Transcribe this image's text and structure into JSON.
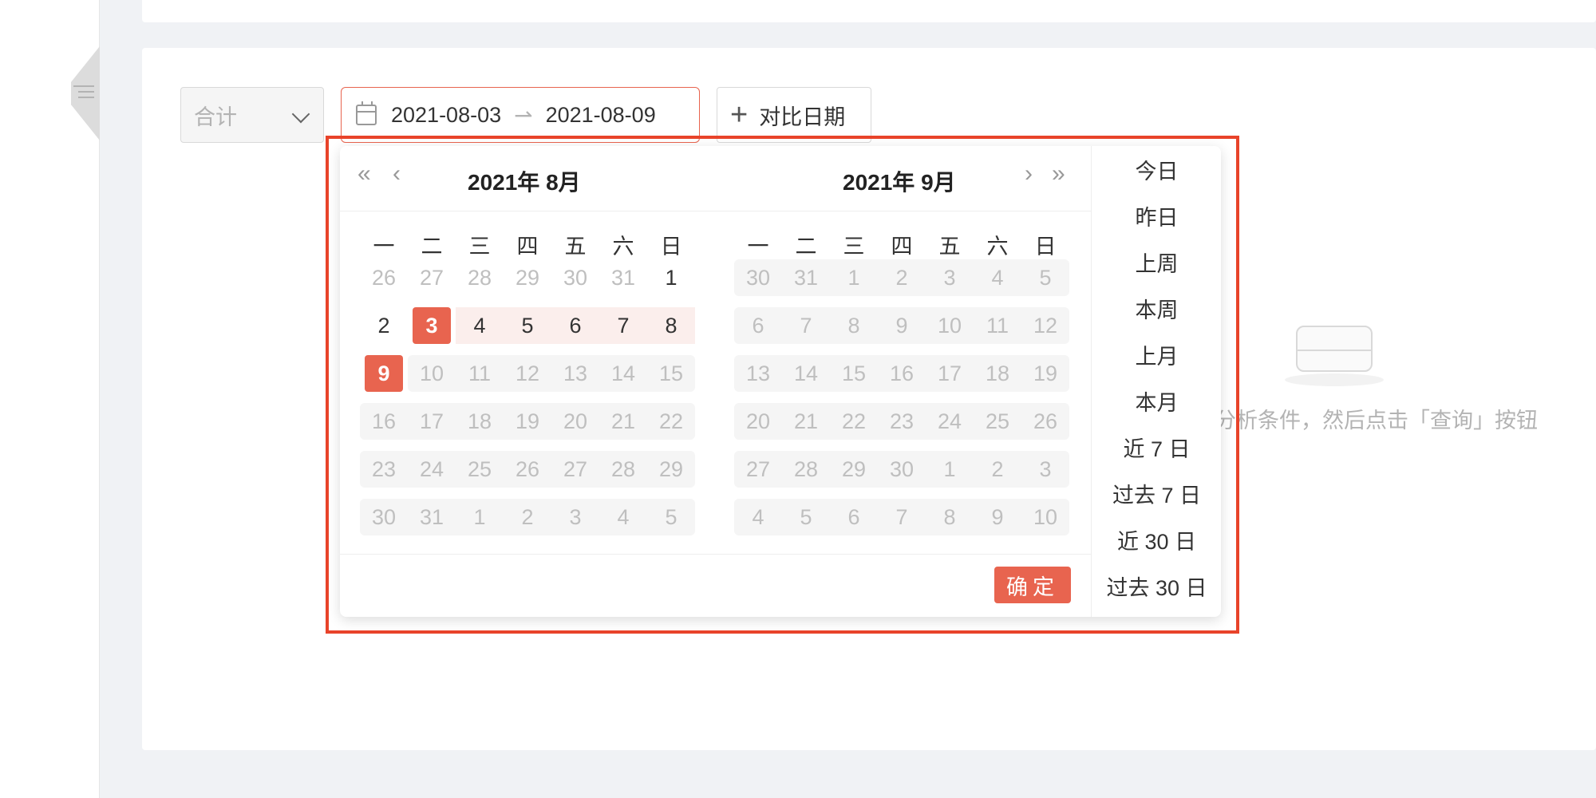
{
  "filter": {
    "aggregate_label": "合计",
    "range_start": "2021-08-03",
    "range_end": "2021-08-09",
    "compare_label": "对比日期"
  },
  "empty_state": {
    "text": "分析条件，然后点击「查询」按钮"
  },
  "calendar": {
    "weekdays": [
      "一",
      "二",
      "三",
      "四",
      "五",
      "六",
      "日"
    ],
    "left": {
      "title": "2021年 8月",
      "days": [
        [
          "26",
          "27",
          "28",
          "29",
          "30",
          "31",
          "1"
        ],
        [
          "2",
          "3",
          "4",
          "5",
          "6",
          "7",
          "8"
        ],
        [
          "9",
          "10",
          "11",
          "12",
          "13",
          "14",
          "15"
        ],
        [
          "16",
          "17",
          "18",
          "19",
          "20",
          "21",
          "22"
        ],
        [
          "23",
          "24",
          "25",
          "26",
          "27",
          "28",
          "29"
        ],
        [
          "30",
          "31",
          "1",
          "2",
          "3",
          "4",
          "5"
        ]
      ]
    },
    "right": {
      "title": "2021年 9月",
      "days": [
        [
          "30",
          "31",
          "1",
          "2",
          "3",
          "4",
          "5"
        ],
        [
          "6",
          "7",
          "8",
          "9",
          "10",
          "11",
          "12"
        ],
        [
          "13",
          "14",
          "15",
          "16",
          "17",
          "18",
          "19"
        ],
        [
          "20",
          "21",
          "22",
          "23",
          "24",
          "25",
          "26"
        ],
        [
          "27",
          "28",
          "29",
          "30",
          "1",
          "2",
          "3"
        ],
        [
          "4",
          "5",
          "6",
          "7",
          "8",
          "9",
          "10"
        ]
      ]
    },
    "ok_label": "确定"
  },
  "presets": [
    "今日",
    "昨日",
    "上周",
    "本周",
    "上月",
    "本月",
    "近 7 日",
    "过去 7 日",
    "近 30 日",
    "过去 30 日"
  ],
  "colors": {
    "accent": "#e8644f",
    "highlight_frame": "#e8432a",
    "range_fill": "#fbeeec"
  }
}
